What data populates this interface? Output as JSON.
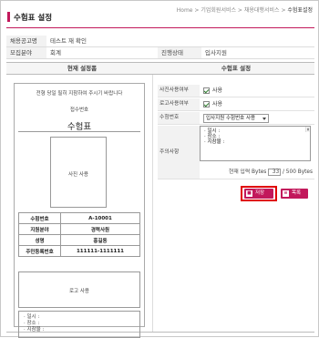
{
  "header": {
    "title": "수험표 설정",
    "breadcrumb": [
      "Home",
      "기업회원서비스",
      "채용대행서비스",
      "수험표설정"
    ],
    "breadcrumb_sep": ">"
  },
  "info": {
    "job_label": "채용공고명",
    "job_value": "테스트 재 확인",
    "field_label": "모집분야",
    "field_value": "회계",
    "status_label": "진행상태",
    "status_value": "입사지원"
  },
  "columns": {
    "left": "현재 설정폼",
    "right": "수험표 설정"
  },
  "ticket": {
    "notice": "전형 당일 필히 지참하여 주시기 바랍니다",
    "serial_label": "접수번호",
    "title": "수험표",
    "photo_label": "사진 사용",
    "rows": [
      {
        "key": "수험번호",
        "value": "A-10001"
      },
      {
        "key": "지원분야",
        "value": "경력사원"
      },
      {
        "key": "성명",
        "value": "홍길동"
      },
      {
        "key": "주민등록번호",
        "value": "111111-1111111"
      }
    ],
    "logo_label": "로고 사용",
    "notes": [
      "· 일시 :",
      "· 장소 :",
      "· 지참물 :"
    ]
  },
  "settings": {
    "photo_use_label": "사진사용여부",
    "photo_use_text": "사용",
    "photo_use_checked": true,
    "logo_use_label": "로고사용여부",
    "logo_use_text": "사용",
    "logo_use_checked": true,
    "ticket_no_label": "수험번호",
    "ticket_no_value": "입사지원 수험번호 사용",
    "notes_label": "주의사항",
    "notes_lines": [
      "· 일시 :",
      "· 장소 :",
      "· 지참물 :"
    ],
    "byte_label": "현재 입력 Bytes",
    "byte_value": "33",
    "byte_max": "/ 500 Bytes"
  },
  "buttons": {
    "save": "저장",
    "list": "목록"
  },
  "colors": {
    "accent": "#c2185b",
    "highlight": "#e00000"
  }
}
